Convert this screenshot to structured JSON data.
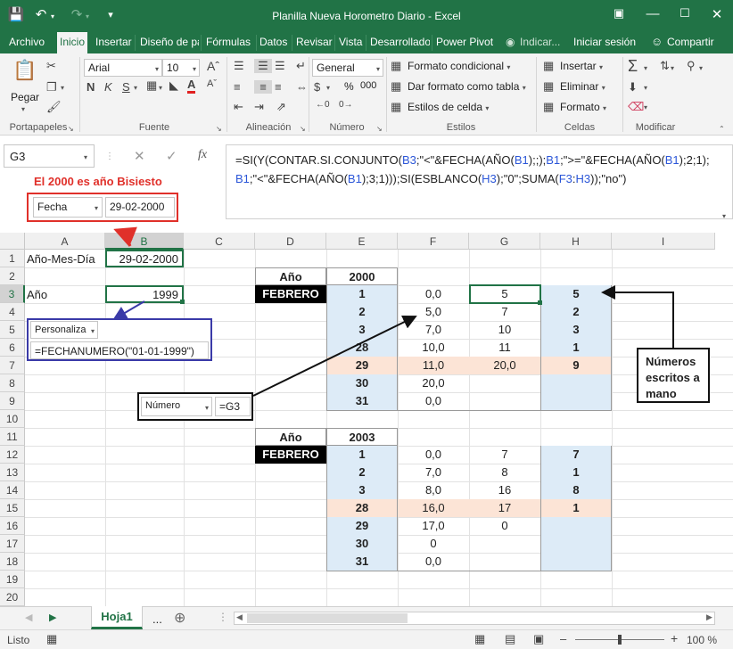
{
  "title": "Planilla Nueva Horometro Diario - Excel",
  "tabs": [
    "Archivo",
    "Inicio",
    "Insertar",
    "Diseño de pá",
    "Fórmulas",
    "Datos",
    "Revisar",
    "Vista",
    "Desarrollado",
    "Power Pivot"
  ],
  "tell_me": "Indicar...",
  "signin": "Iniciar sesión",
  "share": "Compartir",
  "ribbon": {
    "paste": "Pegar",
    "font_name": "Arial",
    "font_size": "10",
    "number_format": "General",
    "percent": "%",
    "thousands": "000",
    "cond_format": "Formato condicional",
    "format_table": "Dar formato como tabla",
    "cell_styles": "Estilos de celda",
    "insert": "Insertar",
    "delete": "Eliminar",
    "format": "Formato",
    "groups": [
      "Portapapeles",
      "Fuente",
      "Alineación",
      "Número",
      "Estilos",
      "Celdas",
      "Modificar"
    ]
  },
  "namebox": "G3",
  "fx": "fx",
  "formula_parts": [
    {
      "t": "=SI(Y(CONTAR.SI.CONJUNTO(",
      "c": 0
    },
    {
      "t": "B3",
      "c": 1
    },
    {
      "t": ";\"<\"&FECHA(AÑO(",
      "c": 0
    },
    {
      "t": "B1",
      "c": 1
    },
    {
      "t": ");;);",
      "c": 0
    },
    {
      "t": "B1",
      "c": 1
    },
    {
      "t": ";\">=\"&FECHA(AÑO(",
      "c": 0
    },
    {
      "t": "B1",
      "c": 1
    },
    {
      "t": ");2;1);",
      "c": 0
    }
  ],
  "formula_parts2": [
    {
      "t": "B1",
      "c": 1
    },
    {
      "t": ";\"<\"&FECHA(AÑO(",
      "c": 0
    },
    {
      "t": "B1",
      "c": 1
    },
    {
      "t": ");3;1)));SI(ESBLANCO(",
      "c": 0
    },
    {
      "t": "H3",
      "c": 1
    },
    {
      "t": ");\"0\";SUMA(",
      "c": 0
    },
    {
      "t": "F3",
      "c": 1
    },
    {
      "t": ":",
      "c": 0
    },
    {
      "t": "H3",
      "c": 1
    },
    {
      "t": "));\"no\")",
      "c": 0
    }
  ],
  "annot": {
    "leap": "El 2000 es año Bisiesto",
    "fmt_fecha": "Fecha",
    "fecha_val": "29-02-2000",
    "fmt_pers": "Personaliza",
    "fechanumero": "=FECHANUMERO(\"01-01-1999\")",
    "fmt_num": "Número",
    "g3ref": "=G3",
    "hand_note": [
      "Números",
      "escritos a",
      "mano"
    ]
  },
  "columns": [
    "A",
    "B",
    "C",
    "D",
    "E",
    "F",
    "G",
    "H",
    "I"
  ],
  "rows": [
    "1",
    "2",
    "3",
    "4",
    "5",
    "6",
    "7",
    "8",
    "9",
    "10",
    "11",
    "12",
    "13",
    "14",
    "15",
    "16",
    "17",
    "18",
    "19",
    "20"
  ],
  "cells": {
    "a1": "Año-Mes-Día",
    "b1": "29-02-2000",
    "a3": "Año",
    "b3": "1999",
    "t1_ano_label": "Año",
    "t1_year": "2000",
    "t1_month": "FEBRERO",
    "t2_ano_label": "Año",
    "t2_year": "2003",
    "t2_month": "FEBRERO"
  },
  "table1": [
    {
      "e": "1",
      "f": "0,0",
      "g": "5",
      "h": "5",
      "hl": false
    },
    {
      "e": "2",
      "f": "5,0",
      "g": "7",
      "h": "2",
      "hl": false
    },
    {
      "e": "3",
      "f": "7,0",
      "g": "10",
      "h": "3",
      "hl": false
    },
    {
      "e": "28",
      "f": "10,0",
      "g": "11",
      "h": "1",
      "hl": false
    },
    {
      "e": "29",
      "f": "11,0",
      "g": "20,0",
      "h": "9",
      "hl": true
    },
    {
      "e": "30",
      "f": "20,0",
      "g": "",
      "h": "",
      "hl": false
    },
    {
      "e": "31",
      "f": "0,0",
      "g": "",
      "h": "",
      "hl": false
    }
  ],
  "table2": [
    {
      "e": "1",
      "f": "0,0",
      "g": "7",
      "h": "7",
      "hl": false
    },
    {
      "e": "2",
      "f": "7,0",
      "g": "8",
      "h": "1",
      "hl": false
    },
    {
      "e": "3",
      "f": "8,0",
      "g": "16",
      "h": "8",
      "hl": false
    },
    {
      "e": "28",
      "f": "16,0",
      "g": "17",
      "h": "1",
      "hl": true
    },
    {
      "e": "29",
      "f": "17,0",
      "g": "0",
      "h": "",
      "hl": false
    },
    {
      "e": "30",
      "f": "0",
      "g": "",
      "h": "",
      "hl": false
    },
    {
      "e": "31",
      "f": "0,0",
      "g": "",
      "h": "",
      "hl": false
    }
  ],
  "sheet_tab": "Hoja1",
  "more_sheets": "...",
  "status": "Listo",
  "zoom": "100 %",
  "colors": {
    "excel_green": "#217346",
    "blue_fill": "#ddebf7",
    "peach_fill": "#fce4d6",
    "red_annot": "#e0302a",
    "blue_annot": "#3a3aa8"
  }
}
